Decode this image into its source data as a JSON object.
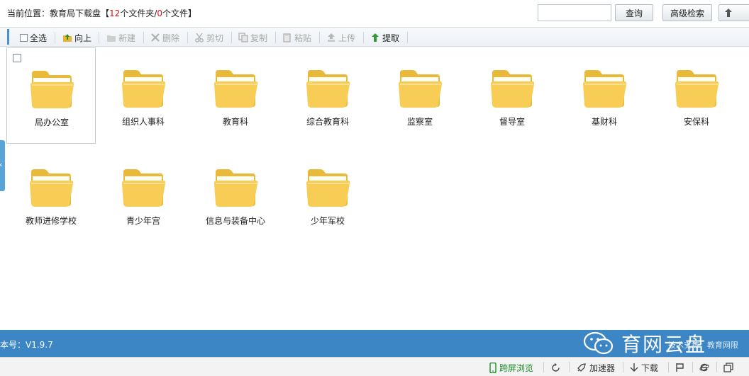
{
  "location": {
    "prefix": "当前位置：",
    "path": "教育局下载盘",
    "bracket_open": "【",
    "folder_count": "12",
    "folder_unit": "个文件夹/",
    "file_count": "0",
    "file_unit": "个文件",
    "bracket_close": "】"
  },
  "search": {
    "value": "",
    "placeholder": ""
  },
  "buttons": {
    "search": "查询",
    "advanced": "高级检索"
  },
  "toolbar": {
    "select_all": "全选",
    "up": "向上",
    "new": "新建",
    "delete": "删除",
    "cut": "剪切",
    "copy": "复制",
    "paste": "粘贴",
    "upload": "上传",
    "extract": "提取"
  },
  "folders": [
    {
      "name": "局办公室"
    },
    {
      "name": "组织人事科"
    },
    {
      "name": "教育科"
    },
    {
      "name": "综合教育科"
    },
    {
      "name": "监察室"
    },
    {
      "name": "督导室"
    },
    {
      "name": "基财科"
    },
    {
      "name": "安保科"
    },
    {
      "name": "教师进修学校"
    },
    {
      "name": "青少年宫"
    },
    {
      "name": "信息与装备中心"
    },
    {
      "name": "少年军校"
    }
  ],
  "status": {
    "version": "本号：V1.9.7",
    "watermark": "育网云盘",
    "support": "技术支持：教育网限"
  },
  "bottom": {
    "cross_screen": "跨屏浏览",
    "accelerator": "加速器",
    "download": "下载"
  },
  "colors": {
    "accent": "#3c86c6",
    "folder": "#f5c842",
    "highlight": "#e01010"
  }
}
